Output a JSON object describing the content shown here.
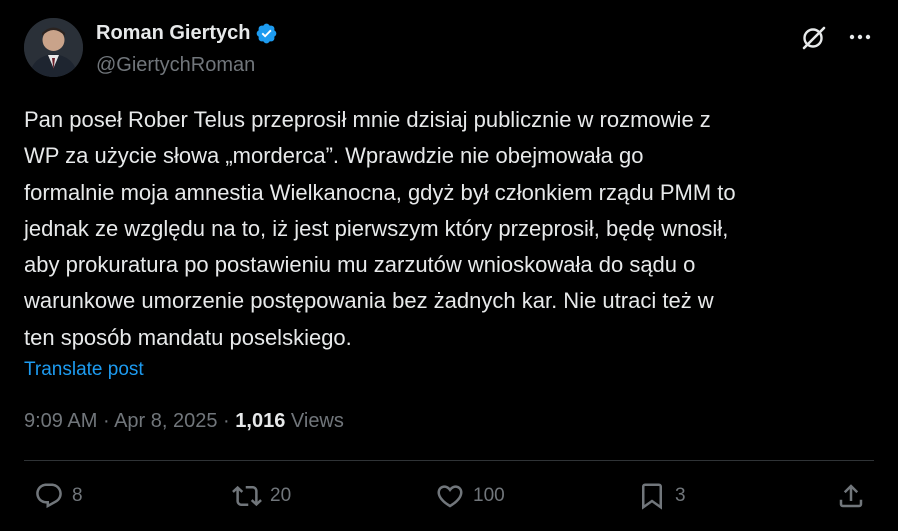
{
  "author": {
    "display_name": "Roman Giertych",
    "handle": "@GiertychRoman",
    "verified": true
  },
  "header_actions": {
    "grok_icon": "grok-icon",
    "more_icon": "more-icon"
  },
  "post": {
    "text": "Pan poseł Rober Telus przeprosił mnie dzisiaj publicznie w rozmowie z\nWP za użycie słowa „morderca”. Wprawdzie nie obejmowała  go\nformalnie moja amnestia Wielkanocna, gdyż był członkiem rządu PMM to\njednak ze względu na to, iż jest pierwszym który przeprosił,  będę wnosił,\naby prokuratura po postawieniu mu zarzutów wnioskowała do sądu o\nwarunkowe umorzenie postępowania bez żadnych kar. Nie utraci też w\nten sposób mandatu poselskiego.",
    "translate_label": "Translate post"
  },
  "meta": {
    "time": "9:09 AM",
    "separator": " · ",
    "date": "Apr 8, 2025",
    "views_count": "1,016",
    "views_label": "Views"
  },
  "actions": {
    "reply_count": "8",
    "repost_count": "20",
    "like_count": "100",
    "bookmark_count": "3"
  },
  "colors": {
    "background": "#000000",
    "text": "#e7e9ea",
    "secondary": "#71767b",
    "link": "#1d9bf0",
    "divider": "#2f3336",
    "verified": "#1d9bf0"
  }
}
